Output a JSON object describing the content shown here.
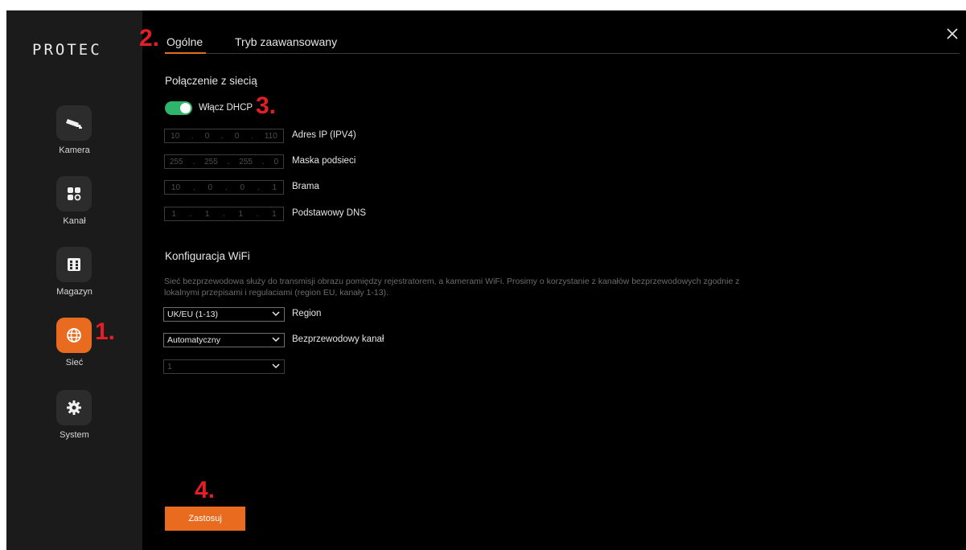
{
  "app": {
    "logo": "PROTEC"
  },
  "sidebar": {
    "items": [
      {
        "label": "Kamera",
        "icon": "camera-icon",
        "active": false
      },
      {
        "label": "Kanał",
        "icon": "grid-icon",
        "active": false
      },
      {
        "label": "Magazyn",
        "icon": "storage-icon",
        "active": false
      },
      {
        "label": "Sieć",
        "icon": "globe-icon",
        "active": true
      },
      {
        "label": "System",
        "icon": "gear-icon",
        "active": false
      }
    ]
  },
  "tabs": [
    {
      "label": "Ogólne",
      "active": true
    },
    {
      "label": "Tryb zaawansowany",
      "active": false
    }
  ],
  "network": {
    "title": "Połączenie z siecią",
    "dhcp_label": "Włącz DHCP",
    "dhcp_enabled": true,
    "fields": [
      {
        "label": "Adres IP (IPV4)",
        "octets": [
          "10",
          "0",
          "0",
          "110"
        ]
      },
      {
        "label": "Maska podsieci",
        "octets": [
          "255",
          "255",
          "255",
          "0"
        ]
      },
      {
        "label": "Brama",
        "octets": [
          "10",
          "0",
          "0",
          "1"
        ]
      },
      {
        "label": "Podstawowy DNS",
        "octets": [
          "1",
          "1",
          "1",
          "1"
        ]
      }
    ]
  },
  "wifi": {
    "title": "Konfiguracja WiFi",
    "description": "Sieć bezprzewodowa służy do transmisji obrazu pomiędzy rejestratorem, a kamerami WiFi. Prosimy o korzystanie z kanałów bezprzewodowych zgodnie z lokalnymi przepisami i regulaciami (region EU, kanały 1-13).",
    "region_value": "UK/EU (1-13)",
    "region_label": "Region",
    "channel_value": "Automatyczny",
    "channel_label": "Bezprzewodowy kanał",
    "channel_number": "1"
  },
  "actions": {
    "apply": "Zastosuj"
  },
  "annotations": [
    "1.",
    "2.",
    "3.",
    "4."
  ],
  "colors": {
    "accent": "#e96b1f",
    "toggle_on": "#2fb46b",
    "annotation": "#e41e26"
  }
}
